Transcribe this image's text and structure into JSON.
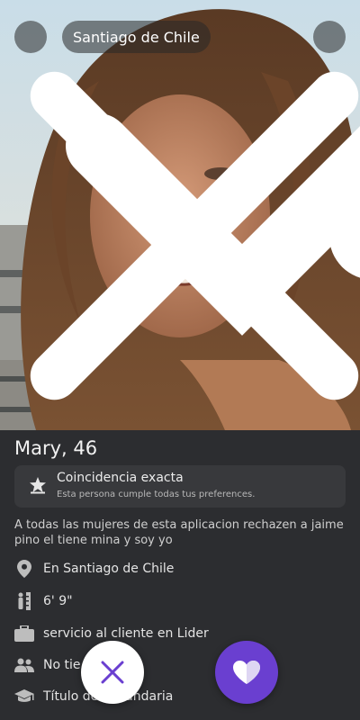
{
  "header": {
    "location": "Santiago de Chile"
  },
  "profile": {
    "name_age": "Mary, 46",
    "match": {
      "title": "Coincidencia exacta",
      "subtitle": "Esta persona cumple todas tus preferences."
    },
    "bio": "A todas las mujeres de esta aplicacion rechazen a jaime pino el tiene mina y soy yo",
    "details": [
      {
        "icon": "location-pin-icon",
        "text": "En Santiago de Chile"
      },
      {
        "icon": "height-ruler-icon",
        "text": "6' 9\""
      },
      {
        "icon": "briefcase-icon",
        "text": "servicio al cliente en Lider"
      },
      {
        "icon": "people-icon",
        "text": "No tie"
      },
      {
        "icon": "graduation-cap-icon",
        "text": "Título de Secundaria"
      }
    ]
  },
  "colors": {
    "background": "#2c2d30",
    "like_button": "#6a3fd0",
    "dislike_x": "#6a3fd0"
  }
}
